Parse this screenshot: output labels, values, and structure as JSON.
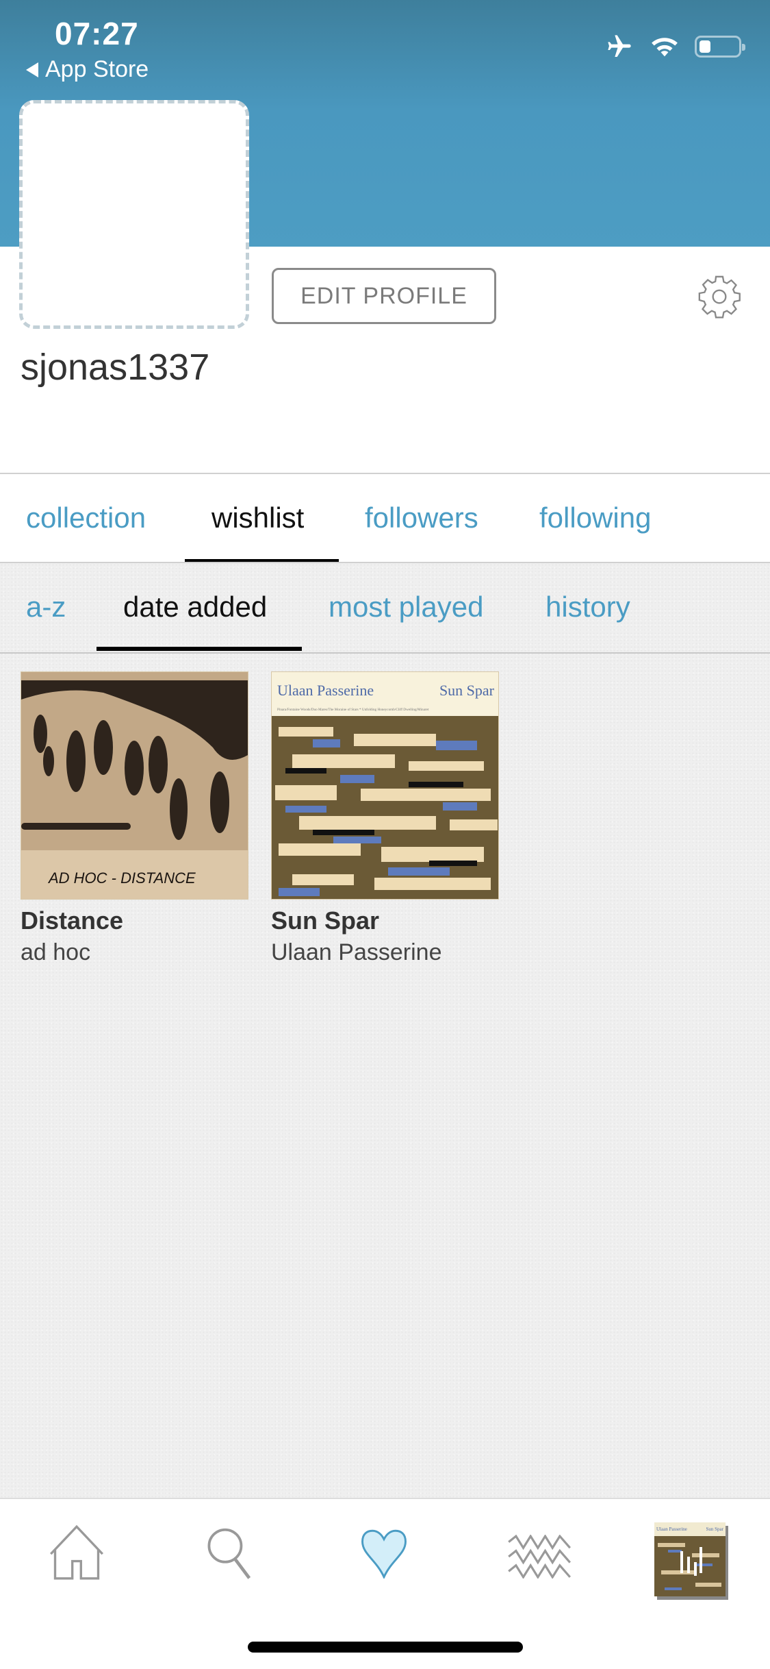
{
  "status_bar": {
    "time": "07:27",
    "back_label": "App Store",
    "icons": [
      "airplane-icon",
      "wifi-icon",
      "battery-icon"
    ],
    "battery_level": 0.3
  },
  "profile": {
    "username": "sjonas1337",
    "edit_button": "EDIT PROFILE",
    "settings_icon": "gear-icon"
  },
  "main_tabs": [
    {
      "label": "collection",
      "active": false
    },
    {
      "label": "wishlist",
      "active": true
    },
    {
      "label": "followers",
      "active": false
    },
    {
      "label": "following",
      "active": false
    }
  ],
  "sort_tabs": [
    {
      "label": "a-z",
      "active": false
    },
    {
      "label": "date added",
      "active": true
    },
    {
      "label": "most played",
      "active": false
    },
    {
      "label": "history",
      "active": false
    }
  ],
  "albums": [
    {
      "title": "Distance",
      "artist": "ad hoc",
      "cover_text": "AD HOC  -  DISTANCE"
    },
    {
      "title": "Sun Spar",
      "artist": "Ulaan Passerine",
      "cover_artist": "Ulaan Passerine",
      "cover_title": "Sun Spar",
      "cover_subtitle": "Pinara/Fontaine Woods/Duo Mares/The Moraine of Stars * Unfolding Honeycomb/Cliff Dwelling/Minaret"
    }
  ],
  "tab_bar": {
    "items": [
      "home-icon",
      "search-icon",
      "heart-icon",
      "feed-icon",
      "now-playing-thumbnail"
    ],
    "active": "heart-icon"
  },
  "colors": {
    "header_blue": "#4d9dc3",
    "link_blue": "#4a9cc4",
    "heart_fill": "#d3eef9",
    "heart_stroke": "#4a9cc4"
  }
}
